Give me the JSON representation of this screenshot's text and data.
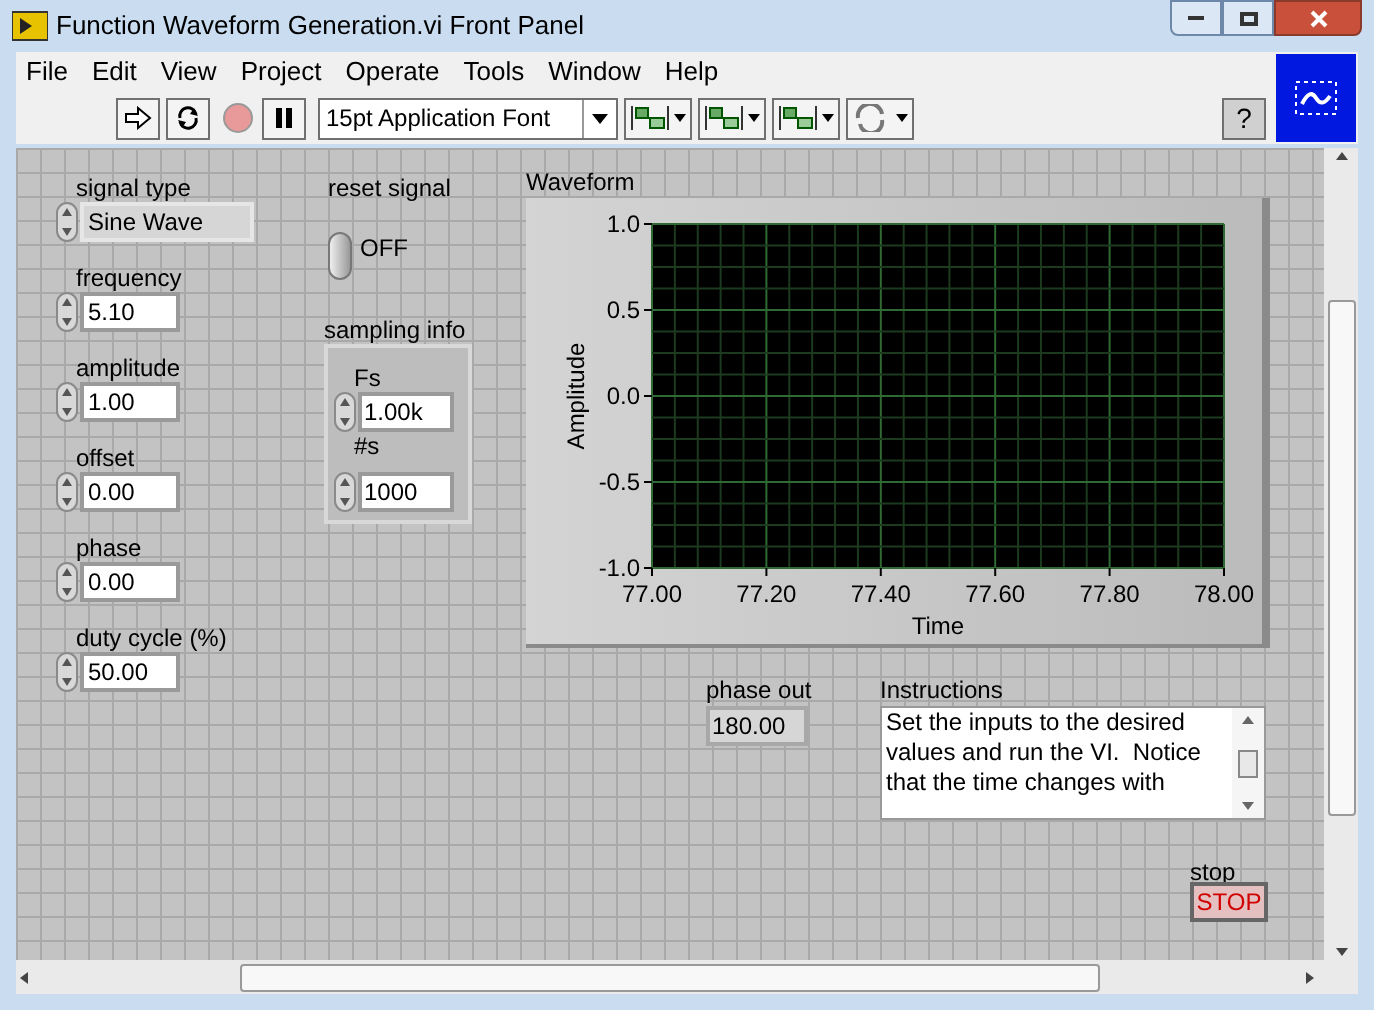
{
  "window": {
    "title": "Function Waveform Generation.vi Front Panel"
  },
  "menu": [
    {
      "label": "File"
    },
    {
      "label": "Edit"
    },
    {
      "label": "View"
    },
    {
      "label": "Project"
    },
    {
      "label": "Operate"
    },
    {
      "label": "Tools"
    },
    {
      "label": "Window"
    },
    {
      "label": "Help"
    }
  ],
  "toolbar": {
    "font_selector": "15pt Application Font",
    "help": "?"
  },
  "inputs": [
    {
      "label": "signal type",
      "value": "Sine Wave",
      "kind": "ring"
    },
    {
      "label": "frequency",
      "value": "5.10",
      "kind": "numeric"
    },
    {
      "label": "amplitude",
      "value": "1.00",
      "kind": "numeric"
    },
    {
      "label": "offset",
      "value": "0.00",
      "kind": "numeric"
    },
    {
      "label": "phase",
      "value": "0.00",
      "kind": "numeric"
    },
    {
      "label": "duty cycle (%)",
      "value": "50.00",
      "kind": "numeric"
    }
  ],
  "reset_signal": {
    "label": "reset signal",
    "on": false,
    "state_text": "OFF"
  },
  "sampling_info": {
    "label": "sampling info",
    "fields": [
      {
        "label": "Fs",
        "value": "1.00k"
      },
      {
        "label": "#s",
        "value": "1000"
      }
    ]
  },
  "waveform": {
    "label": "Waveform",
    "chart_data": {
      "type": "line",
      "grid": true,
      "xlabel": "Time",
      "ylabel": "Amplitude",
      "xlim": [
        77,
        78
      ],
      "ylim": [
        -1,
        1
      ],
      "xticks": [
        {
          "value": 77,
          "label": "77.00"
        },
        {
          "value": 77.2,
          "label": "77.20"
        },
        {
          "value": 77.4,
          "label": "77.40"
        },
        {
          "value": 77.6,
          "label": "77.60"
        },
        {
          "value": 77.8,
          "label": "77.80"
        },
        {
          "value": 78,
          "label": "78.00"
        }
      ],
      "yticks": [
        {
          "value": 1,
          "label": "1.0"
        },
        {
          "value": 0.5,
          "label": "0.5"
        },
        {
          "value": 0,
          "label": "0.0"
        },
        {
          "value": -0.5,
          "label": "-0.5"
        },
        {
          "value": -1,
          "label": "-1.0"
        }
      ]
    }
  },
  "phase_out": {
    "label": "phase out",
    "value": "180.00"
  },
  "instructions": {
    "label": "Instructions",
    "text": "Set the inputs to the desired values and run the VI.  Notice that the time changes with"
  },
  "stop": {
    "label": "stop",
    "text": "STOP"
  }
}
